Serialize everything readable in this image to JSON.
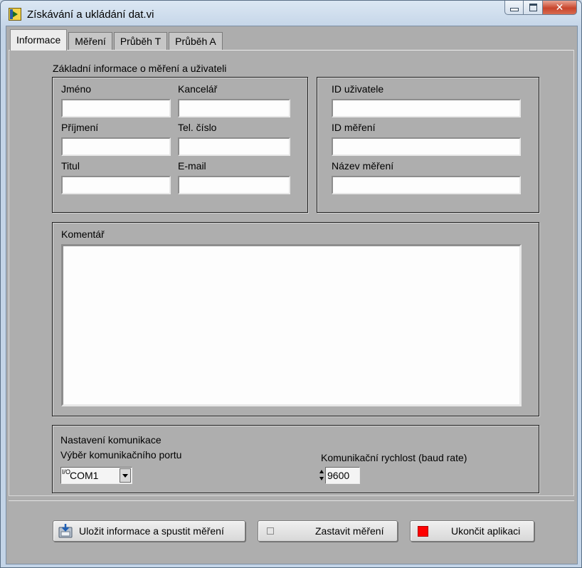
{
  "window": {
    "title": "Získávání a ukládání dat.vi",
    "minimize_glyph": "",
    "maximize_glyph": "",
    "close_glyph": "✕"
  },
  "tabs": [
    "Informace",
    "Měření",
    "Průběh T",
    "Průběh A"
  ],
  "info_tab": {
    "section_title": "Základní informace o měření a uživateli",
    "left_group": {
      "labels": [
        "Jméno",
        "Kancelář",
        "Příjmení",
        "Tel. číslo",
        "Titul",
        "E-mail"
      ],
      "values": [
        "",
        "",
        "",
        "",
        "",
        ""
      ]
    },
    "right_group": {
      "labels": [
        "ID uživatele",
        "ID měření",
        "Název měření"
      ],
      "values": [
        "",
        "",
        ""
      ]
    },
    "comment": {
      "label": "Komentář",
      "value": ""
    },
    "communication": {
      "title": "Nastavení komunikace",
      "port_label": "Výběr komunikačního portu",
      "port_io_glyph": "I/O",
      "port_value": "COM1",
      "baud_label": "Komunikační rychlost (baud rate)",
      "baud_value": "9600"
    }
  },
  "buttons": {
    "save_start": "Uložit informace a spustit měření",
    "stop": "Zastavit měření",
    "quit": "Ukončit aplikaci"
  },
  "colors": {
    "panel_gray": "#adadad",
    "active_tab": "#ececec",
    "quit_led": "#ff0000",
    "close_button": "#c8452c"
  }
}
